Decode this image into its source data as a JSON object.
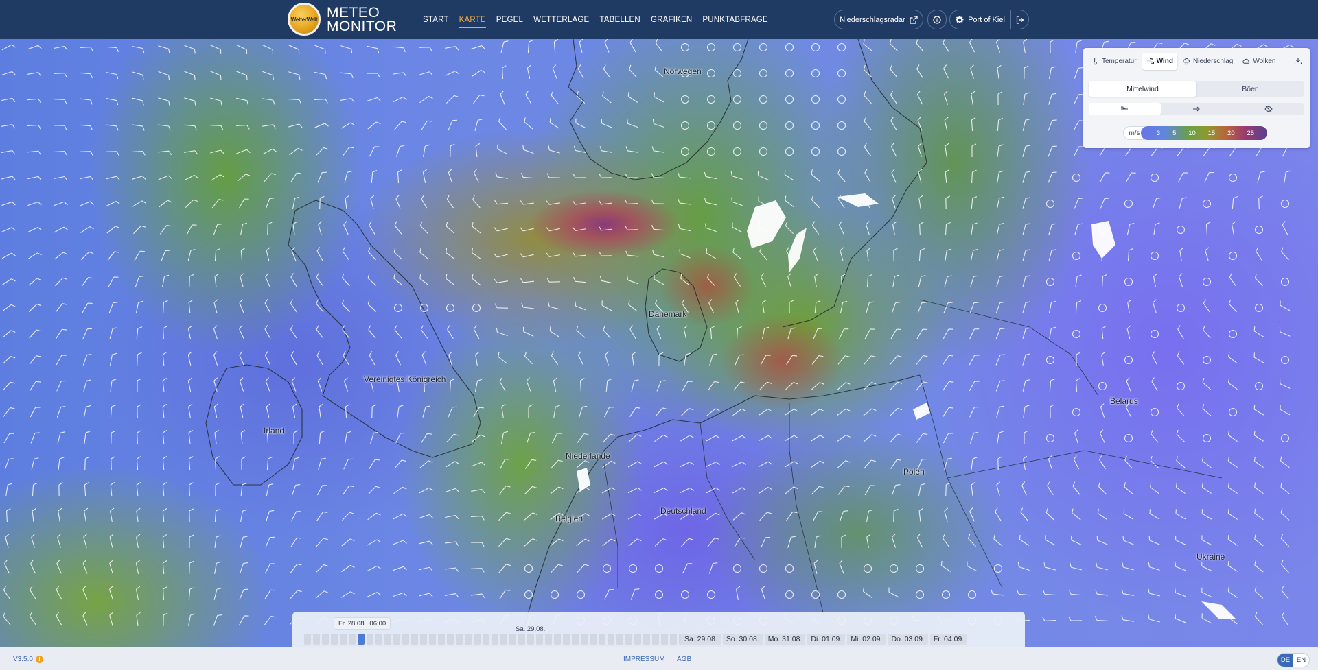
{
  "header": {
    "logo_text": "WetterWelt",
    "brand_line1": "METEO",
    "brand_line2": "MONITOR",
    "nav": [
      {
        "label": "START",
        "active": false
      },
      {
        "label": "KARTE",
        "active": true
      },
      {
        "label": "PEGEL",
        "active": false
      },
      {
        "label": "WETTERLAGE",
        "active": false
      },
      {
        "label": "TABELLEN",
        "active": false
      },
      {
        "label": "GRAFIKEN",
        "active": false
      },
      {
        "label": "PUNKTABFRAGE",
        "active": false
      }
    ],
    "radar_button": "Niederschlagsradar",
    "location_button": "Port of Kiel"
  },
  "map": {
    "countries": [
      {
        "name": "Norwegen"
      },
      {
        "name": "Dänemark"
      },
      {
        "name": "Vereinigtes Königreich"
      },
      {
        "name": "Irland"
      },
      {
        "name": "Niederlande"
      },
      {
        "name": "Belgien"
      },
      {
        "name": "Deutschland"
      },
      {
        "name": "Polen"
      },
      {
        "name": "Belarus"
      },
      {
        "name": "Ukraine"
      }
    ]
  },
  "panel": {
    "tabs": [
      {
        "label": "Temperatur",
        "icon": "thermometer-icon",
        "active": false
      },
      {
        "label": "Wind",
        "icon": "wind-icon",
        "active": true
      },
      {
        "label": "Niederschlag",
        "icon": "rain-cloud-icon",
        "active": false
      },
      {
        "label": "Wolken",
        "icon": "cloud-icon",
        "active": false
      }
    ],
    "modes": [
      {
        "label": "Mittelwind",
        "active": true
      },
      {
        "label": "Böen",
        "active": false
      }
    ],
    "display_options": [
      "wind-barb-icon",
      "arrow-right-icon",
      "eye-off-icon"
    ],
    "legend": {
      "unit": "m/s",
      "values": [
        "3",
        "5",
        "10",
        "15",
        "20",
        "25"
      ]
    }
  },
  "timeline": {
    "tooltip": "Fr. 28.08., 06:00",
    "current_day_label": "Sa. 29.08.",
    "hour_slots": 44,
    "active_slot": 6,
    "days": [
      "Sa. 29.08.",
      "So. 30.08.",
      "Mo. 31.08.",
      "Di. 01.09.",
      "Mi. 02.09.",
      "Do. 03.09.",
      "Fr. 04.09."
    ]
  },
  "footer": {
    "version": "V3.5.0",
    "warning_badge": "!",
    "impressum": "IMPRESSUM",
    "agb": "AGB",
    "languages": [
      {
        "code": "DE",
        "active": true
      },
      {
        "code": "EN",
        "active": false
      }
    ]
  },
  "colors": {
    "header_bg": "#1f3a63",
    "accent": "#f2a93b",
    "link": "#3c68b8"
  }
}
